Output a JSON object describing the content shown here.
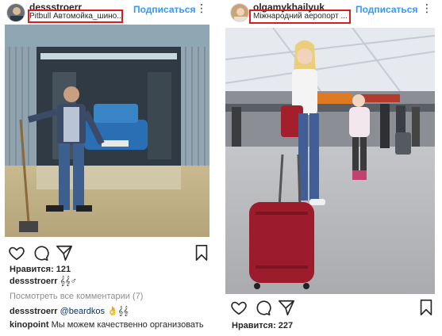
{
  "left_post": {
    "username": "dessstroerr",
    "location": "Pitbull Автомойка_шино...",
    "follow_label": "Подписаться",
    "more_label": "⋮",
    "likes": "Нравится: 121",
    "caption_user": "dessstroerr",
    "caption_text": "𝄞𝄞♂",
    "view_comments": "Посмотреть все комментарии (7)",
    "comment1_user": "dessstroerr",
    "comment1_mention": "@beardkos",
    "comment1_emoji": "👌𝄞𝄞",
    "comment2_user": "kinopoint",
    "comment2_text": "Мы можем качественно организовать"
  },
  "right_post": {
    "username": "olgamykhailyuk",
    "location": "Міжнародний аеропорт ...",
    "follow_label": "Подписаться",
    "more_label": "⋮",
    "likes": "Нравится: 227"
  },
  "colors": {
    "accent": "#3897f0",
    "highlight_box": "#e0191f",
    "text": "#262626",
    "muted": "#8e8e8e"
  },
  "icons": [
    "heart-icon",
    "comment-icon",
    "share-icon",
    "bookmark-icon",
    "more-icon"
  ]
}
